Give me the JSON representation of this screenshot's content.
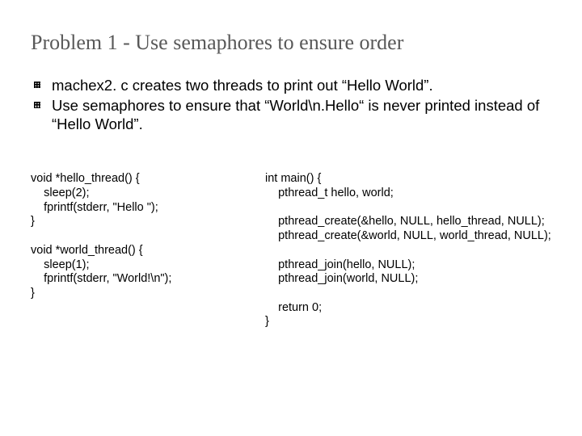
{
  "title": "Problem 1 - Use semaphores to ensure order",
  "bullets": [
    "machex2. c creates two threads to print out “Hello World”.",
    "Use semaphores to ensure that “World\\n.Hello“ is never printed instead of “Hello World”."
  ],
  "code_left": "void *hello_thread() {\n    sleep(2);\n    fprintf(stderr, \"Hello \");\n}\n\nvoid *world_thread() {\n    sleep(1);\n    fprintf(stderr, \"World!\\n\");\n}",
  "code_right": "int main() {\n    pthread_t hello, world;\n\n    pthread_create(&hello, NULL, hello_thread, NULL);\n    pthread_create(&world, NULL, world_thread, NULL);\n\n    pthread_join(hello, NULL);\n    pthread_join(world, NULL);\n\n    return 0;\n}"
}
